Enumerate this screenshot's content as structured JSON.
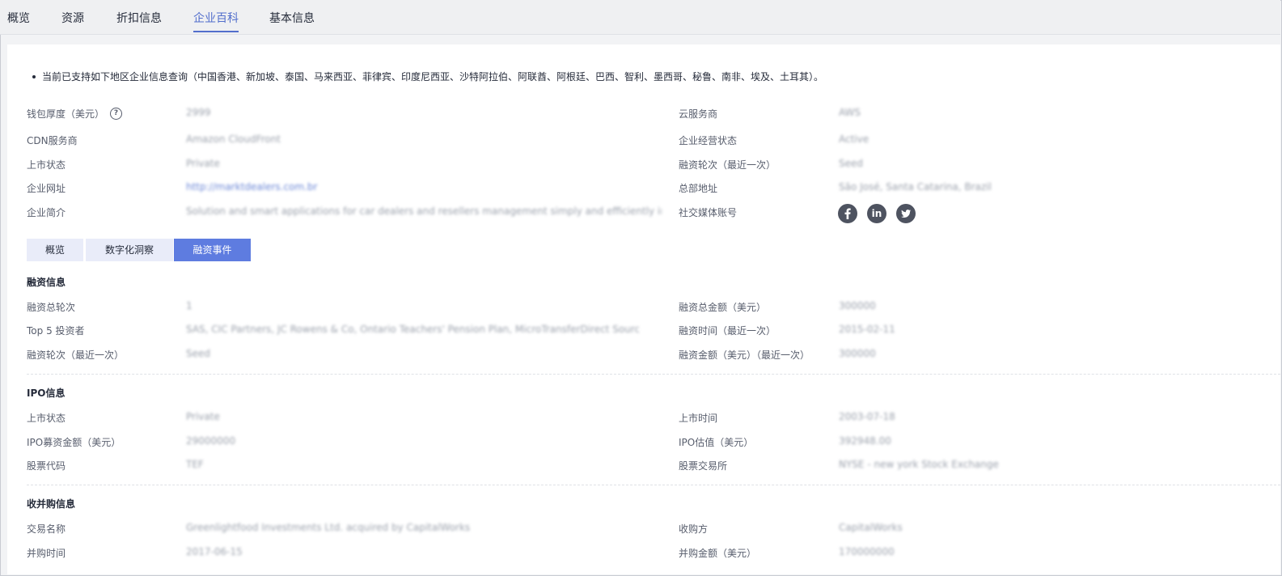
{
  "nav": {
    "tabs": [
      "概览",
      "资源",
      "折扣信息",
      "企业百科",
      "基本信息"
    ],
    "active_index": 3
  },
  "notice": "当前已支持如下地区企业信息查询（中国香港、新加坡、泰国、马来西亚、菲律宾、印度尼西亚、沙特阿拉伯、阿联酋、阿根廷、巴西、智利、墨西哥、秘鲁、南非、埃及、土耳其）。",
  "basic": {
    "wallet_label": "钱包厚度（美元）",
    "wallet_value": "2999",
    "cdn_label": "CDN服务商",
    "cdn_value": "Amazon CloudFront",
    "listing_label": "上市状态",
    "listing_value": "Private",
    "website_label": "企业网址",
    "website_value": "http://marktdealers.com.br",
    "intro_label": "企业简介",
    "intro_value": "Solution and smart applications for car dealers and resellers management simply and efficiently integrati...",
    "cloud_label": "云服务商",
    "cloud_value": "AWS",
    "status_label": "企业经营状态",
    "status_value": "Active",
    "round_label": "融资轮次（最近一次）",
    "round_value": "Seed",
    "hq_label": "总部地址",
    "hq_value": "São José, Santa Catarina, Brazil",
    "social_label": "社交媒体账号"
  },
  "social_icons": [
    "facebook-icon",
    "linkedin-icon",
    "twitter-icon"
  ],
  "subtabs": [
    "概览",
    "数字化洞察",
    "融资事件"
  ],
  "subtab_active": 2,
  "funding": {
    "title": "融资信息",
    "total_rounds_label": "融资总轮次",
    "total_rounds_value": "1",
    "investors_label": "Top 5 投资者",
    "investors_value": "SAS, CIC Partners, JC Rowens & Co, Ontario Teachers' Pension Plan, MicroTransferDirect Source",
    "last_round_label": "融资轮次（最近一次）",
    "last_round_value": "Seed",
    "total_amount_label": "融资总金额（美元）",
    "total_amount_value": "300000",
    "last_time_label": "融资时间（最近一次）",
    "last_time_value": "2015-02-11",
    "last_amount_label": "融资金额（美元）（最近一次）",
    "last_amount_value": "300000"
  },
  "ipo": {
    "title": "IPO信息",
    "status_label": "上市状态",
    "status_value": "Private",
    "raised_label": "IPO募资金额（美元）",
    "raised_value": "29000000",
    "ticker_label": "股票代码",
    "ticker_value": "TEF",
    "time_label": "上市时间",
    "time_value": "2003-07-18",
    "valuation_label": "IPO估值（美元）",
    "valuation_value": "392948.00",
    "exchange_label": "股票交易所",
    "exchange_value": "NYSE - new york Stock Exchange"
  },
  "acquisition": {
    "title": "收并购信息",
    "deal_label": "交易名称",
    "deal_value": "Greenlightfood Investments Ltd. acquired by CapitalWorks",
    "time_label": "并购时间",
    "time_value": "2017-06-15",
    "acquirer_label": "收购方",
    "acquirer_value": "CapitalWorks",
    "amount_label": "并购金额（美元）",
    "amount_value": "170000000"
  }
}
